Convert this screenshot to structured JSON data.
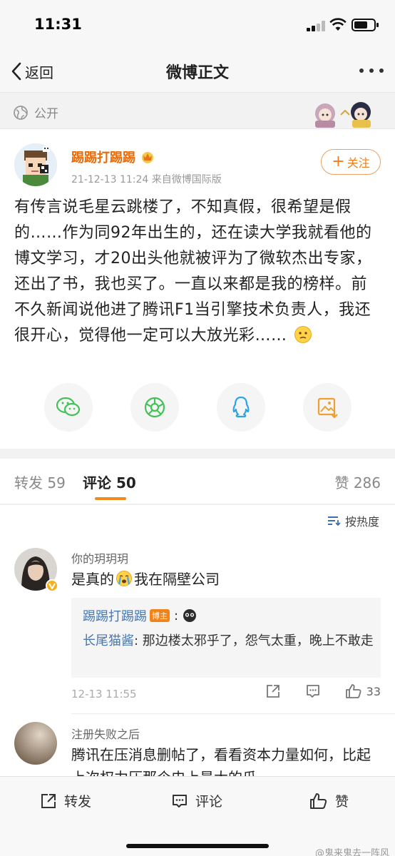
{
  "status_bar": {
    "time": "11:31",
    "battery_level": 0.7
  },
  "nav": {
    "back_label": "返回",
    "title": "微博正文"
  },
  "visibility": {
    "label": "公开"
  },
  "post": {
    "author": "踢踢打踢踢",
    "meta": "21-12-13 11:24  来自微博国际版",
    "follow_label": "关注",
    "text": "有传言说毛星云跳楼了，不知真假，很希望是假的……作为同92年出生的，还在读大学我就看他的博文学习，才20出头他就被评为了微软杰出专家，还出了书，我也买了。一直以来都是我的榜样。前不久新闻说他进了腾讯F1当引擎技术负责人，我还很开心，觉得他一定可以大放光彩……",
    "share_icons": [
      "wechat-icon",
      "moments-icon",
      "qq-icon",
      "save-image-icon"
    ]
  },
  "tabs": {
    "repost": "转发 59",
    "comments": "评论 50",
    "likes": "赞 286"
  },
  "sort_label": "按热度",
  "comments": [
    {
      "name": "你的玥玥玥",
      "text_before": "是真的",
      "text_after": "我在隔壁公司",
      "reply": {
        "author": "踢踢打踢踢",
        "tag": "博主",
        "colon": ":",
        "at": "长尾猫酱",
        "text": ": 那边楼太邪乎了，怨气太重，晚上不敢走"
      },
      "time": "12-13 11:55",
      "likes": "33"
    },
    {
      "name": "注册失败之后",
      "text": "腾讯在压消息删帖了，看看资本力量如何，比起上次权力压那个史上最大的瓜"
    }
  ],
  "bottom_bar": {
    "repost": "转发",
    "comment": "评论",
    "like": "赞"
  },
  "watermark": "@鬼来鬼去一阵风",
  "colors": {
    "accent": "#f08a1a",
    "author": "#e86b0a",
    "link": "#4a78b0"
  }
}
